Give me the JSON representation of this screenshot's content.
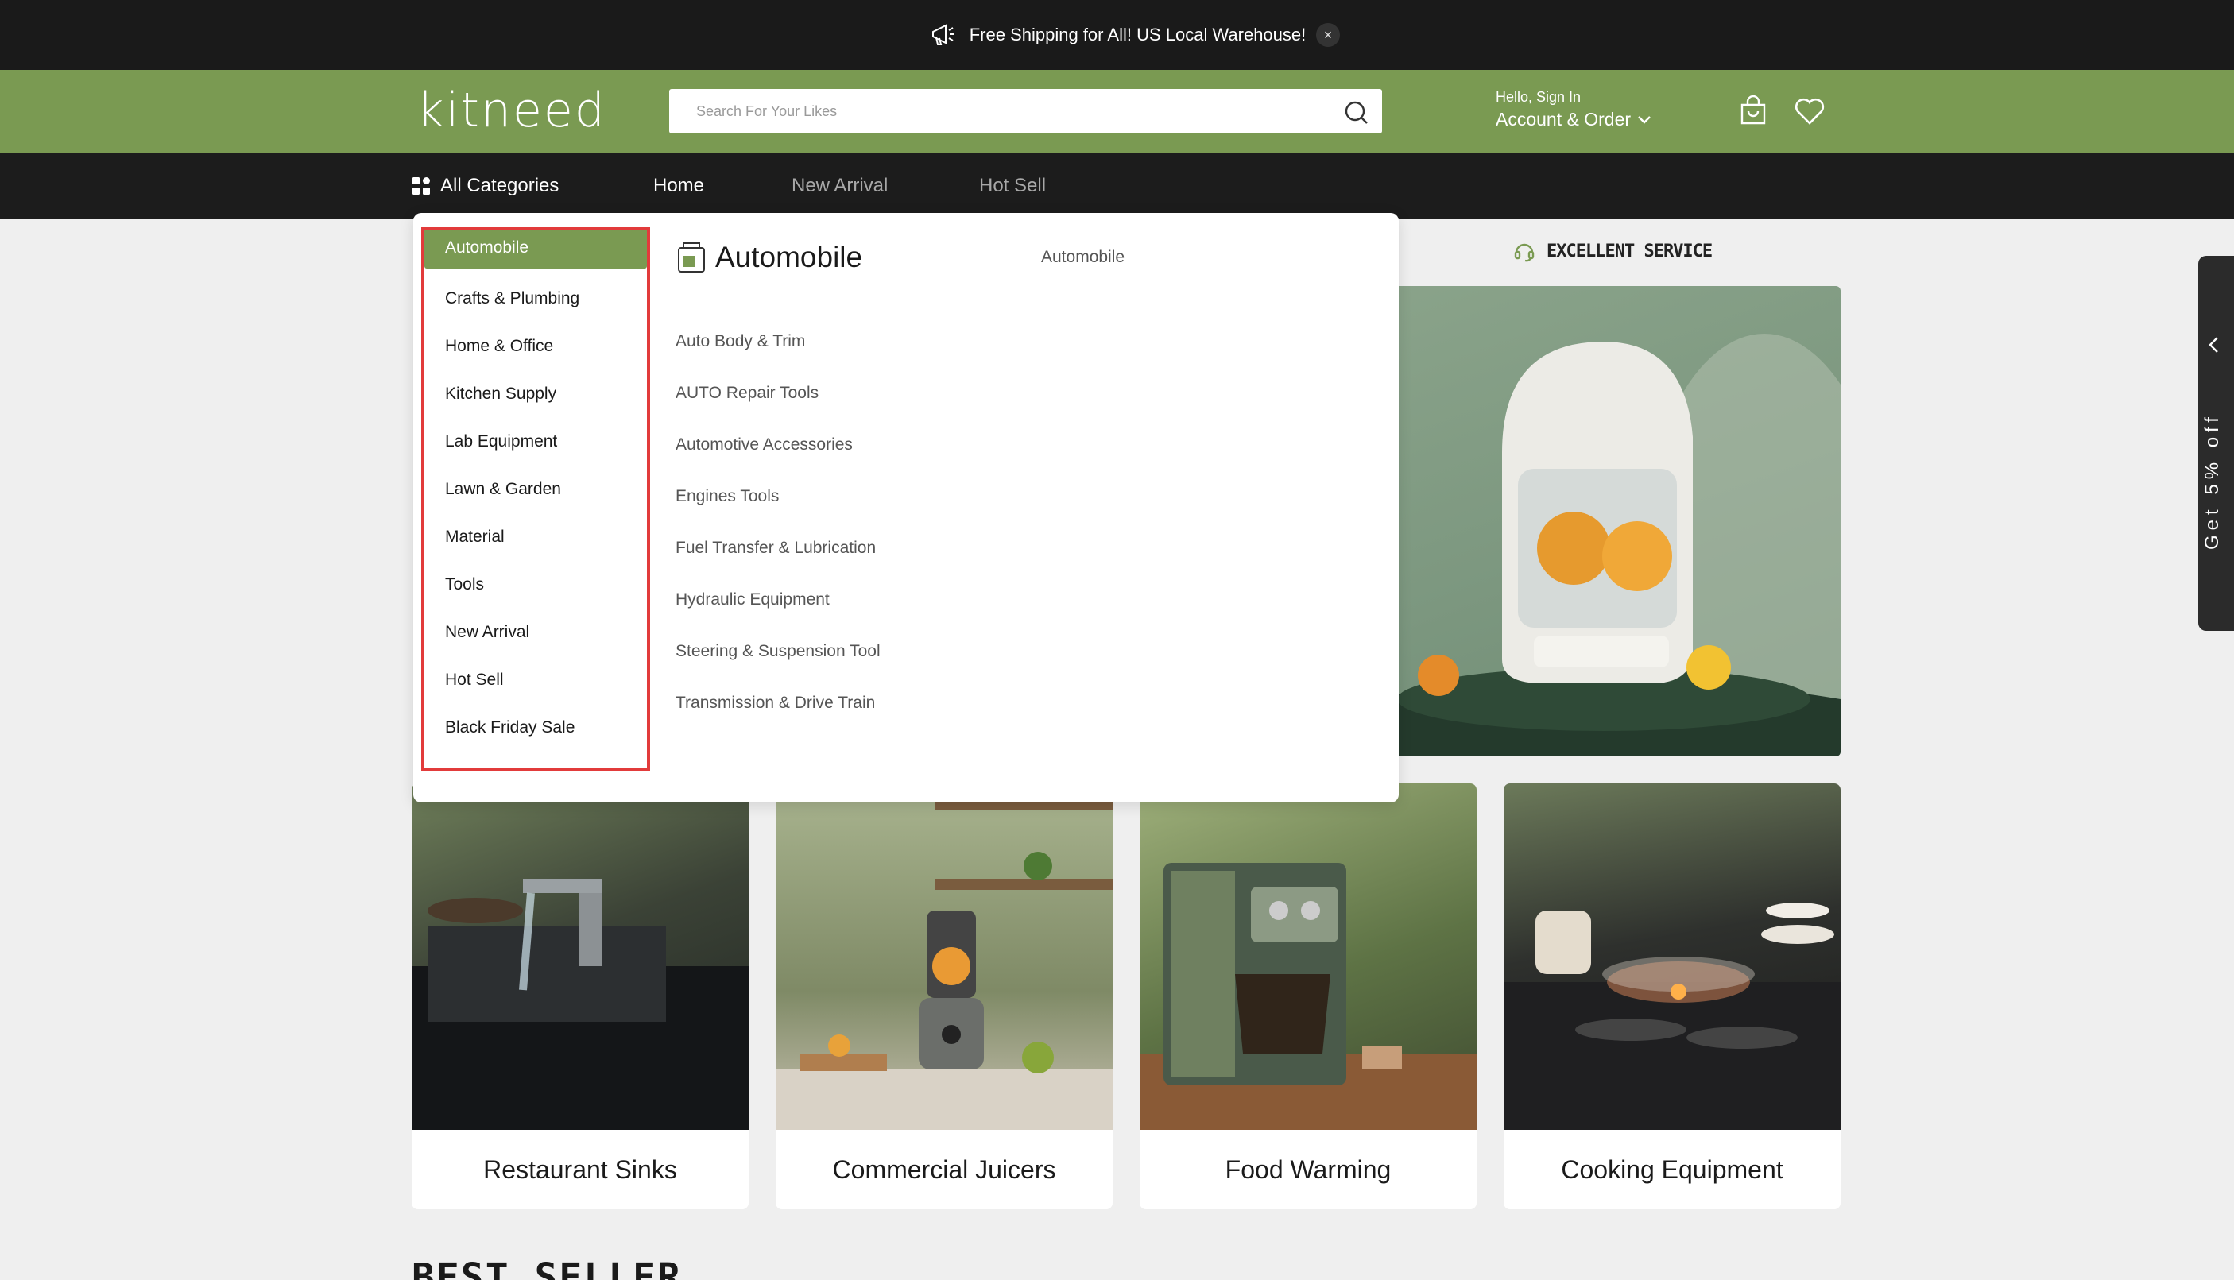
{
  "announcement": {
    "text": "Free Shipping for All! US Local Warehouse!",
    "close": "×"
  },
  "header": {
    "logo": "kitneed",
    "search_placeholder": "Search For Your Likes",
    "hello": "Hello, Sign In",
    "account": "Account & Order"
  },
  "nav": {
    "all_categories": "All Categories",
    "items": [
      "Home",
      "New Arrival",
      "Hot Sell"
    ]
  },
  "mega_menu": {
    "categories": [
      "Automobile",
      "Crafts & Plumbing",
      "Home & Office",
      "Kitchen Supply",
      "Lab Equipment",
      "Lawn & Garden",
      "Material",
      "Tools",
      "New Arrival",
      "Hot Sell",
      "Black Friday Sale"
    ],
    "active_category": "Automobile",
    "sub_title": "Automobile",
    "sub_link": "Automobile",
    "sub_items": [
      "Auto Body & Trim",
      "AUTO Repair Tools",
      "Automotive Accessories",
      "Engines Tools",
      "Fuel Transfer & Lubrication",
      "Hydraulic Equipment",
      "Steering & Suspension Tool",
      "Transmission & Drive Train"
    ]
  },
  "service_label": "EXCELLENT SERVICE",
  "side_promo": "Get 5% off",
  "cards": [
    {
      "label": "Restaurant Sinks"
    },
    {
      "label": "Commercial Juicers"
    },
    {
      "label": "Food Warming"
    },
    {
      "label": "Cooking Equipment"
    }
  ],
  "section_title": "BEST SELLER",
  "colors": {
    "brand_green": "#7a9a52",
    "dark": "#1c1c1c",
    "highlight_red": "#e23b3b"
  }
}
